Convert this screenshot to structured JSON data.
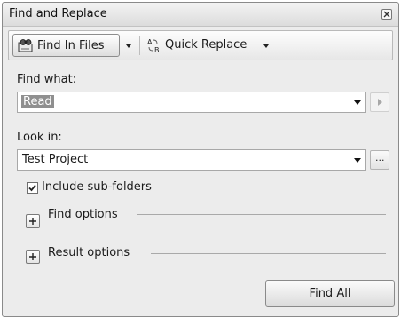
{
  "window": {
    "title": "Find and Replace"
  },
  "toolbar": {
    "find_in_files_label": "Find In Files",
    "quick_replace_label": "Quick Replace",
    "find_in_files_icon": "binoculars-folder-icon",
    "quick_replace_icon": "replace-ab-icon"
  },
  "find": {
    "label": "Find what:",
    "value": "Read"
  },
  "look_in": {
    "label": "Look in:",
    "value": "Test Project",
    "browse_label": "..."
  },
  "options": {
    "include_subfolders_label": "Include sub-folders",
    "include_subfolders_checked": true,
    "find_options_label": "Find options",
    "result_options_label": "Result options"
  },
  "actions": {
    "find_all_label": "Find All"
  }
}
